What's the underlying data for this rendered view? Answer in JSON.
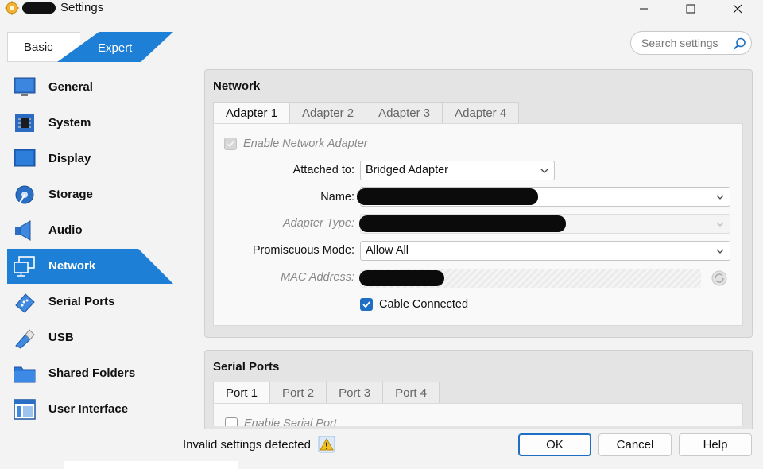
{
  "window": {
    "title": "Settings"
  },
  "mode_tabs": {
    "basic": "Basic",
    "expert": "Expert"
  },
  "search": {
    "placeholder": "Search settings"
  },
  "sidebar": {
    "items": [
      {
        "label": "General",
        "icon": "monitor-icon"
      },
      {
        "label": "System",
        "icon": "chip-icon"
      },
      {
        "label": "Display",
        "icon": "display-icon"
      },
      {
        "label": "Storage",
        "icon": "disk-icon"
      },
      {
        "label": "Audio",
        "icon": "speaker-icon"
      },
      {
        "label": "Network",
        "icon": "network-icon",
        "selected": true
      },
      {
        "label": "Serial Ports",
        "icon": "serial-port-icon"
      },
      {
        "label": "USB",
        "icon": "usb-icon"
      },
      {
        "label": "Shared Folders",
        "icon": "folder-icon"
      },
      {
        "label": "User Interface",
        "icon": "window-icon"
      }
    ]
  },
  "network": {
    "title": "Network",
    "tabs": [
      "Adapter 1",
      "Adapter 2",
      "Adapter 3",
      "Adapter 4"
    ],
    "enable_label": "Enable Network Adapter",
    "attached_label": "Attached to:",
    "attached_value": "Bridged Adapter",
    "name_label": "Name:",
    "adapter_type_label": "Adapter Type:",
    "promiscuous_label": "Promiscuous Mode:",
    "promiscuous_value": "Allow All",
    "mac_label": "MAC Address:",
    "cable_label": "Cable Connected"
  },
  "serial": {
    "title": "Serial Ports",
    "tabs": [
      "Port 1",
      "Port 2",
      "Port 3",
      "Port 4"
    ],
    "enable_label": "Enable Serial Port"
  },
  "footer": {
    "status": "Invalid settings detected",
    "ok": "OK",
    "cancel": "Cancel",
    "help": "Help"
  },
  "colors": {
    "accent": "#1e7fd6",
    "checkbox": "#1e6fc4"
  }
}
